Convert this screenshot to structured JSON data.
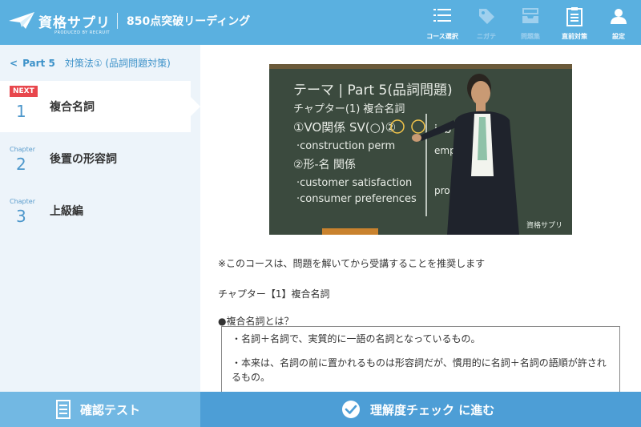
{
  "header": {
    "logo_text": "資格サプリ",
    "logo_sub": "PRODUCED BY RECRUIT",
    "course_title": "850点突破リーディング",
    "nav": [
      {
        "label": "コース選択",
        "icon": "list-icon"
      },
      {
        "label": "ニガテ",
        "icon": "tag-icon"
      },
      {
        "label": "問題集",
        "icon": "tray-icon"
      },
      {
        "label": "直前対策",
        "icon": "clipboard-icon"
      },
      {
        "label": "設定",
        "icon": "user-icon"
      }
    ]
  },
  "sidebar": {
    "back_part": "Part 5",
    "back_title": "対策法① (品詞問題対策)",
    "chapters": [
      {
        "badge": "NEXT",
        "caption": "",
        "number": "1",
        "title": "複合名詞",
        "active": true
      },
      {
        "badge": "",
        "caption": "Chapter",
        "number": "2",
        "title": "後置の形容詞",
        "active": false
      },
      {
        "badge": "",
        "caption": "Chapter",
        "number": "3",
        "title": "上級編",
        "active": false
      }
    ]
  },
  "video": {
    "watermark": "資格サプリ",
    "board_lines": [
      "テーマ | Part 5(品詞問題)",
      "チャプター(1) 複合名詞",
      "①VO関係 SV(○)②",
      "·construction perm",
      "②形-名 関係",
      "·customer satisfaction",
      "·consumer preferences",
      "job on",
      "empl",
      "produc"
    ]
  },
  "main": {
    "note": "※このコースは、問題を解いてから受講することを推奨します",
    "chapter_heading": "チャプター【1】複合名詞",
    "definition_heading": "●複合名詞とは？",
    "definition_lines": [
      "・名詞＋名詞で、実質的に一語の名詞となっているもの。",
      "・本来は、名詞の前に置かれるものは形容詞だが、慣用的に名詞＋名詞の語順が許されるもの。"
    ]
  },
  "footer": {
    "test_label": "確認テスト",
    "next_label": "理解度チェック に進む"
  },
  "colors": {
    "header_bg": "#5ab0e0",
    "sidebar_bg": "#edf4fa",
    "badge": "#e8474d",
    "footer_left": "#72b8e3",
    "footer_right": "#4d9ed6"
  }
}
